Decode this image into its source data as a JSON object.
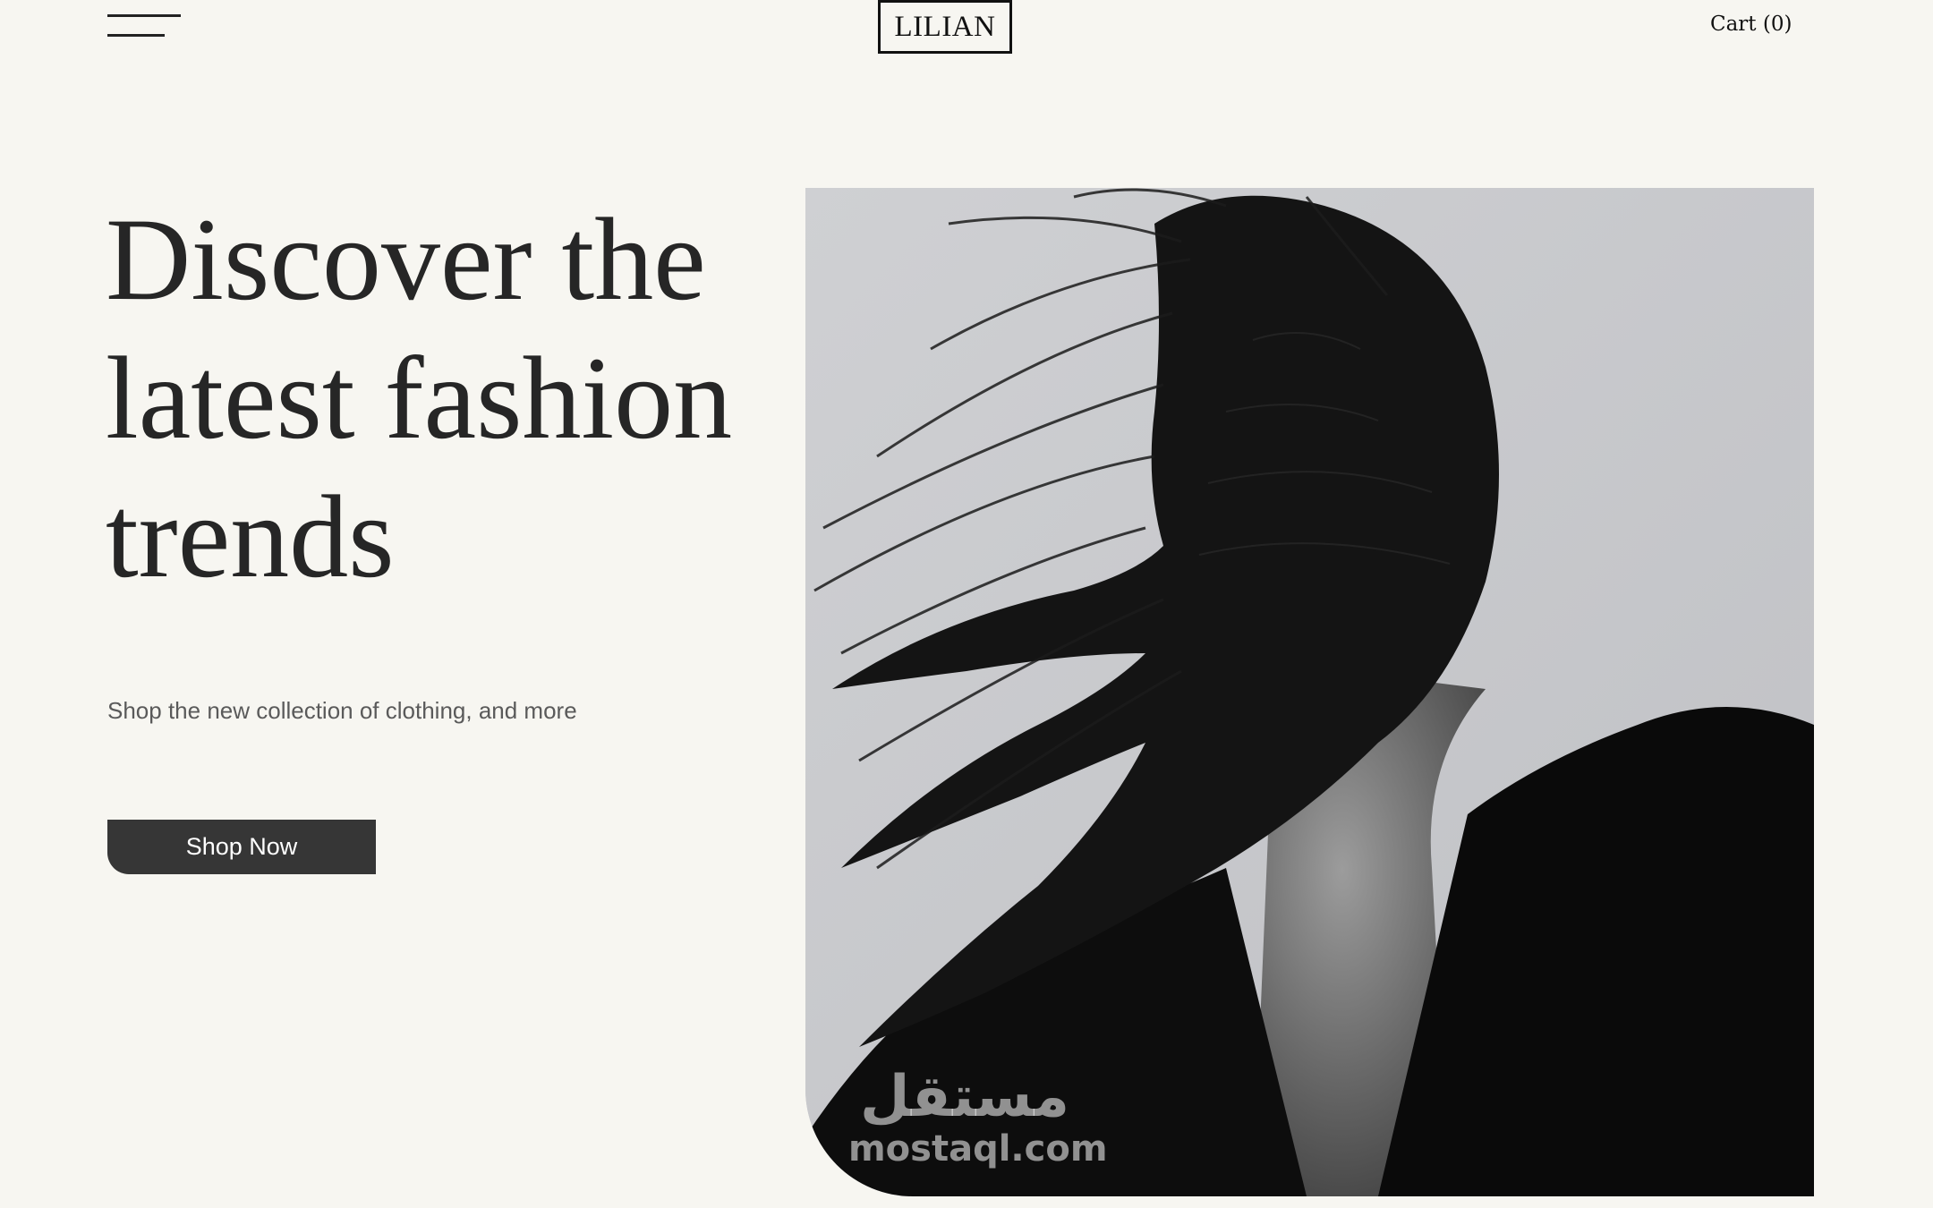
{
  "header": {
    "menu_icon": "hamburger-menu-icon",
    "logo_text": "LILIAN",
    "cart_label": "Cart (0)"
  },
  "hero": {
    "heading": "Discover the latest fashion trends",
    "subtitle": "Shop the new collection of clothing, and more",
    "cta_label": "Shop Now",
    "image_description": "black-and-white portrait photo"
  },
  "watermark": {
    "arabic": "مستقل",
    "latin": "mostaql.com"
  },
  "colors": {
    "background": "#f7f6f1",
    "text_dark": "#262626",
    "button_bg": "#363636",
    "button_text": "#ffffff"
  }
}
